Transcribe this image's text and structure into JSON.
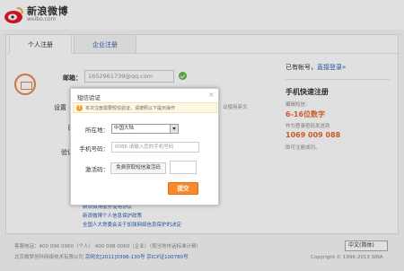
{
  "header": {
    "logo_text": "新浪微博",
    "logo_url": "weibo.com"
  },
  "tabs": {
    "personal": "个人注册",
    "enterprise": "企业注册"
  },
  "form": {
    "email_label": "邮箱：",
    "email_value": "1652961739@qq.com",
    "bg_label_1": "设置",
    "bg_label_2": "昵",
    "bg_label_3": "验证",
    "bg_right_text": "议使用英文",
    "links": [
      "新浪微博服务使用协议",
      "新浪微博个人信息保护政策",
      "全国人大常委会关于加强网络信息保护的决定"
    ]
  },
  "right": {
    "have_account": "已有帐号，",
    "login_link": "直接登录»",
    "title": "手机快速注册",
    "line1": "编辑短信：",
    "code": "6-16位数字",
    "line2": "作为登录密码发送到",
    "number": "1069 009 088",
    "line3": "即可注册成功。"
  },
  "footer": {
    "line1": "客服电话：400 096 0960（个人） 400 098 0060（企业）（按当地市话标准计费）",
    "company": "北京微梦创科网络技术有限公司",
    "icp1": "京网文[2011]0398-130号",
    "icp2": "京ICP证100780号",
    "lang": "中文(简体)",
    "copyright": "Copyright © 1996-2013 SINA"
  },
  "modal": {
    "title": "短信验证",
    "close": "×",
    "notice_icon": "!",
    "notice": "本次注册需要短信验证，请按照以下提示操作",
    "location_label": "所在地：",
    "location_value": "中国大陆",
    "phone_label": "手机号码：",
    "phone_placeholder": "0086 请输入您的手机号码",
    "code_label": "激活码：",
    "get_code": "免费获取短信激活码",
    "submit": "提交"
  },
  "colors": {
    "accent": "#f88a2d",
    "link": "#2e5fae",
    "highlight": "#e8662a"
  }
}
